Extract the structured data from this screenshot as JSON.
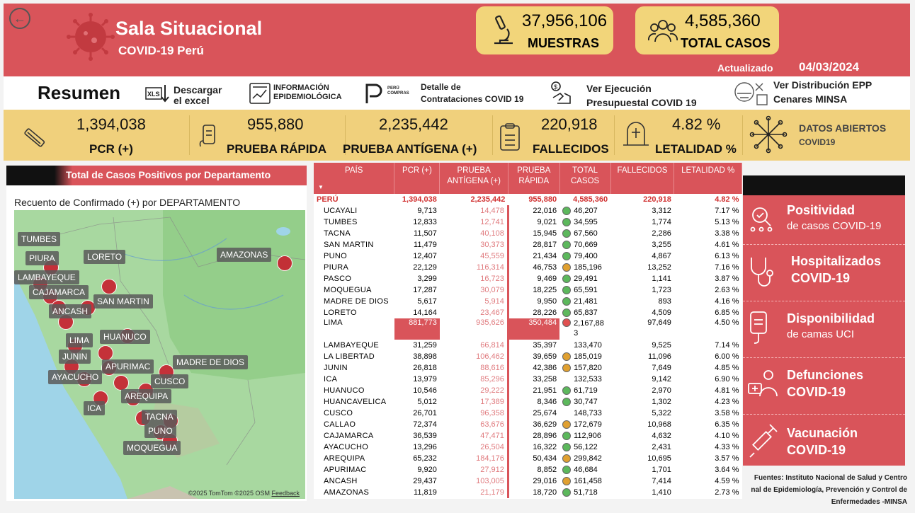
{
  "header": {
    "title": "Sala Situacional",
    "subtitle": "COVID-19 Perú",
    "muestras_value": "37,956,106",
    "muestras_label": "MUESTRAS",
    "casos_value": "4,585,360",
    "casos_label": "TOTAL CASOS",
    "updated_label": "Actualizado",
    "updated_date": "04/03/2024",
    "colors": {
      "brand_red": "#d9545a",
      "gold": "#f0d07c"
    }
  },
  "links": {
    "resumen": "Resumen",
    "excel_1": "Descargar",
    "excel_2": "el excel",
    "epi_1": "INFORMACIÓN",
    "epi_2": "EPIDEMIOLÓGICA",
    "compras_logo_1": "PERÚ",
    "compras_logo_2": "COMPRAS",
    "contr_1": "Detalle de",
    "contr_2": "Contrataciones COVID 19",
    "ejec_1": "Ver Ejecución",
    "ejec_2": "Presupuestal COVID 19",
    "epp_1": "Ver Distribución EPP",
    "epp_2": "Cenares MINSA"
  },
  "kpis": {
    "pcr_value": "1,394,038",
    "pcr_label": "PCR (+)",
    "rapida_value": "955,880",
    "rapida_label": "PRUEBA RÁPIDA",
    "antigena_value": "2,235,442",
    "antigena_label": "PRUEBA ANTÍGENA (+)",
    "fallecidos_value": "220,918",
    "fallecidos_label": "FALLECIDOS",
    "letalidad_value": "4.82 %",
    "letalidad_label": "LETALIDAD %",
    "abiertos_1": "DATOS ABIERTOS",
    "abiertos_2": "COVID19"
  },
  "map": {
    "title": "Total de Casos Positivos por Departamento",
    "subtitle": "Recuento de Confirmado (+) por DEPARTAMENTO",
    "attribution": "©2025 TomTom ©2025 OSM",
    "feedback": "Feedback",
    "labels": [
      "TUMBES",
      "PIURA",
      "LAMBAYEQUE",
      "CAJAMARCA",
      "ANCASH",
      "LORETO",
      "SAN MARTIN",
      "AMAZONAS",
      "LIMA",
      "HUANUCO",
      "JUNIN",
      "APURIMAC",
      "AYACUCHO",
      "MADRE DE DIOS",
      "CUSCO",
      "AREQUIPA",
      "ICA",
      "TACNA",
      "PUNO",
      "MOQUEGUA"
    ]
  },
  "table": {
    "headers": [
      "PAÍS",
      "PCR (+)",
      "PRUEBA ANTÍGENA (+)",
      "PRUEBA RÁPIDA",
      "TOTAL CASOS",
      "FALLECIDOS",
      "LETALIDAD %"
    ],
    "total": [
      "PERÚ",
      "1,394,038",
      "2,235,442",
      "955,880",
      "4,585,360",
      "220,918",
      "4.82 %"
    ],
    "rows": [
      [
        "UCAYALI",
        "9,713",
        "14,478",
        "22,016",
        "46,207",
        "3,312",
        "7.17 %",
        "green"
      ],
      [
        "TUMBES",
        "12,833",
        "12,741",
        "9,021",
        "34,595",
        "1,774",
        "5.13 %",
        "green"
      ],
      [
        "TACNA",
        "11,507",
        "40,108",
        "15,945",
        "67,560",
        "2,286",
        "3.38 %",
        "green"
      ],
      [
        "SAN MARTIN",
        "11,479",
        "30,373",
        "28,817",
        "70,669",
        "3,255",
        "4.61 %",
        "green"
      ],
      [
        "PUNO",
        "12,407",
        "45,559",
        "21,434",
        "79,400",
        "4,867",
        "6.13 %",
        "green"
      ],
      [
        "PIURA",
        "22,129",
        "116,314",
        "46,753",
        "185,196",
        "13,252",
        "7.16 %",
        "orange"
      ],
      [
        "PASCO",
        "3,299",
        "16,723",
        "9,469",
        "29,491",
        "1,141",
        "3.87 %",
        "green"
      ],
      [
        "MOQUEGUA",
        "17,287",
        "30,079",
        "18,225",
        "65,591",
        "1,723",
        "2.63 %",
        "green"
      ],
      [
        "MADRE DE DIOS",
        "5,617",
        "5,914",
        "9,950",
        "21,481",
        "893",
        "4.16 %",
        "green"
      ],
      [
        "LORETO",
        "14,164",
        "23,467",
        "28,226",
        "65,837",
        "4,509",
        "6.85 %",
        "green"
      ],
      [
        "LIMA",
        "881,773",
        "935,626",
        "350,484",
        "2,167,883",
        "97,649",
        "4.50 %",
        "red"
      ],
      [
        "LAMBAYEQUE",
        "31,259",
        "66,814",
        "35,397",
        "133,470",
        "9,525",
        "7.14 %",
        "none"
      ],
      [
        "LA LIBERTAD",
        "38,898",
        "106,462",
        "39,659",
        "185,019",
        "11,096",
        "6.00 %",
        "orange"
      ],
      [
        "JUNIN",
        "26,818",
        "88,616",
        "42,386",
        "157,820",
        "7,649",
        "4.85 %",
        "orange"
      ],
      [
        "ICA",
        "13,979",
        "85,296",
        "33,258",
        "132,533",
        "9,142",
        "6.90 %",
        "none"
      ],
      [
        "HUANUCO",
        "10,546",
        "29,222",
        "21,951",
        "61,719",
        "2,970",
        "4.81 %",
        "green"
      ],
      [
        "HUANCAVELICA",
        "5,012",
        "17,389",
        "8,346",
        "30,747",
        "1,302",
        "4.23 %",
        "green"
      ],
      [
        "CUSCO",
        "26,701",
        "96,358",
        "25,674",
        "148,733",
        "5,322",
        "3.58 %",
        "none"
      ],
      [
        "CALLAO",
        "72,374",
        "63,676",
        "36,629",
        "172,679",
        "10,968",
        "6.35 %",
        "orange"
      ],
      [
        "CAJAMARCA",
        "36,539",
        "47,471",
        "28,896",
        "112,906",
        "4,632",
        "4.10 %",
        "green"
      ],
      [
        "AYACUCHO",
        "13,296",
        "26,504",
        "16,322",
        "56,122",
        "2,431",
        "4.33 %",
        "green"
      ],
      [
        "AREQUIPA",
        "65,232",
        "184,176",
        "50,434",
        "299,842",
        "10,695",
        "3.57 %",
        "orange"
      ],
      [
        "APURIMAC",
        "9,920",
        "27,912",
        "8,852",
        "46,684",
        "1,701",
        "3.64 %",
        "green"
      ],
      [
        "ANCASH",
        "29,437",
        "103,005",
        "29,016",
        "161,458",
        "7,414",
        "4.59 %",
        "orange"
      ],
      [
        "AMAZONAS",
        "11,819",
        "21,179",
        "18,720",
        "51,718",
        "1,410",
        "2.73 %",
        "green"
      ]
    ]
  },
  "right_panel": {
    "positividad_1": "Positividad",
    "positividad_2": "de casos COVID-19",
    "hosp_1": "Hospitalizados",
    "hosp_2": "COVID-19",
    "camas_1": "Disponibilidad",
    "camas_2": "de camas UCI",
    "def_1": "Defunciones",
    "def_2": "COVID-19",
    "vac_1": "Vacunación",
    "vac_2": "COVID-19",
    "sources": "Fuentes: Instituto Nacional de Salud y Centro nal de Epidemiología, Prevención y Control de Enfermedades -MINSA"
  }
}
